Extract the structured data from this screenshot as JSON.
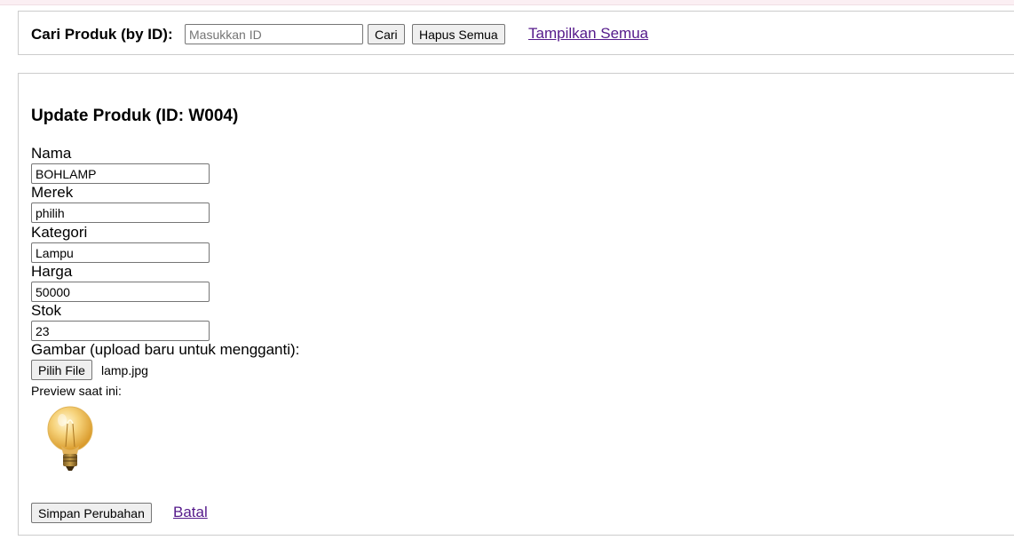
{
  "search": {
    "label": "Cari Produk (by ID):",
    "placeholder": "Masukkan ID",
    "value": "",
    "cari_button": "Cari",
    "hapus_button": "Hapus Semua",
    "show_all_link": "Tampilkan Semua"
  },
  "form": {
    "title": "Update Produk (ID: W004)",
    "fields": [
      {
        "label": "Nama",
        "value": "BOHLAMP"
      },
      {
        "label": "Merek",
        "value": "philih"
      },
      {
        "label": "Kategori",
        "value": "Lampu"
      },
      {
        "label": "Harga",
        "value": "50000"
      },
      {
        "label": "Stok",
        "value": "23"
      }
    ],
    "image_label": "Gambar (upload baru untuk mengganti):",
    "file_button": "Pilih File",
    "file_name": "lamp.jpg",
    "preview_label": "Preview saat ini:",
    "preview_icon": "light-bulb-icon",
    "save_button": "Simpan Perubahan",
    "cancel_link": "Batal"
  },
  "colors": {
    "link_visited": "#551a8b",
    "button_bg": "#efefef",
    "border": "#cccccc",
    "bulb_glass": "#f3c04a"
  }
}
